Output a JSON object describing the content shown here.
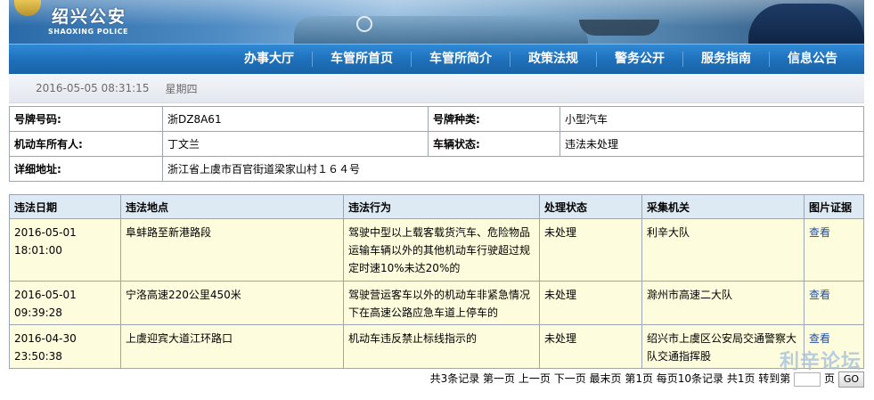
{
  "brand": {
    "name_cn": "绍兴公安",
    "name_en": "SHAOXING POLICE"
  },
  "nav": [
    "办事大厅",
    "车管所首页",
    "车管所简介",
    "政策法规",
    "警务公开",
    "服务指南",
    "信息公告"
  ],
  "datebar": {
    "datetime": "2016-05-05 08:31:15",
    "weekday": "星期四"
  },
  "vehicle": {
    "plate_label": "号牌号码:",
    "plate": "浙DZ8A61",
    "plate_type_label": "号牌种类:",
    "plate_type": "小型汽车",
    "owner_label": "机动车所有人:",
    "owner": "丁文兰",
    "status_label": "车辆状态:",
    "status": "违法未处理",
    "address_label": "详细地址:",
    "address": "浙江省上虞市百官街道梁家山村１６４号"
  },
  "violations": {
    "headers": [
      "违法日期",
      "违法地点",
      "违法行为",
      "处理状态",
      "采集机关",
      "图片证据"
    ],
    "rows": [
      {
        "date": "2016-05-01",
        "time": "18:01:00",
        "location": "阜蚌路至新港路段",
        "behavior": "驾驶中型以上载客载货汽车、危险物品运输车辆以外的其他机动车行驶超过规定时速10%未达20%的",
        "status": "未处理",
        "agency": "利辛大队",
        "evidence": "查看"
      },
      {
        "date": "2016-05-01",
        "time": "09:39:28",
        "location": "宁洛高速220公里450米",
        "behavior": "驾驶营运客车以外的机动车非紧急情况下在高速公路应急车道上停车的",
        "status": "未处理",
        "agency": "滁州市高速二大队",
        "evidence": "查看"
      },
      {
        "date": "2016-04-30",
        "time": "23:50:38",
        "location": "上虞迎宾大道江环路口",
        "behavior": "机动车违反禁止标线指示的",
        "status": "未处理",
        "agency": "绍兴市上虞区公安局交通警察大队交通指挥股",
        "evidence": "查看"
      }
    ]
  },
  "pager": {
    "summary": "共3条记录 第一页 上一页 下一页 最末页 第1页 每页10条记录 共1页 转到第",
    "suffix": "页",
    "go": "GO"
  },
  "watermark": "利辛论坛"
}
